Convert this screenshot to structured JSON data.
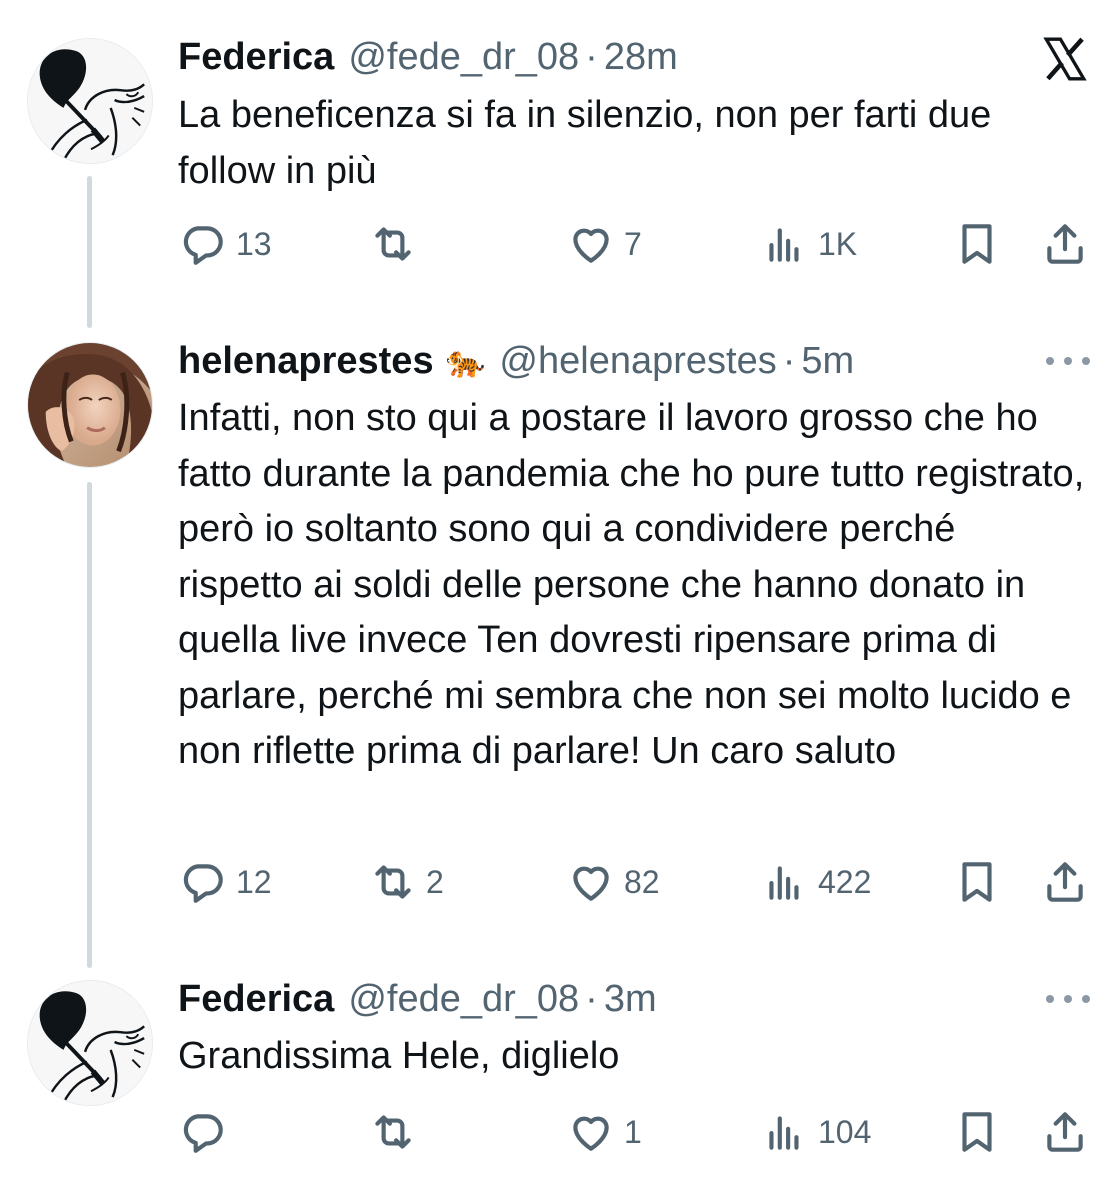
{
  "tweets": [
    {
      "display_name": "Federica",
      "handle": "@fede_dr_08",
      "separator": "·",
      "time": "28m",
      "text": "La beneficenza si fa in silenzio, non per farti due follow in più",
      "replies": "13",
      "retweets": "",
      "likes": "7",
      "views": "1K",
      "corner_icon": "x-logo-icon",
      "avatar": "sketch-avatar"
    },
    {
      "display_name": "helenaprestes",
      "name_emoji": "🐅",
      "handle": "@helenaprestes",
      "separator": "·",
      "time": "5m",
      "text": "Infatti, non sto qui a postare il lavoro grosso che ho fatto durante la pandemia che ho pure tutto registrato, però io soltanto sono qui a condividere perché rispetto ai soldi delle persone che hanno donato in quella live invece Ten dovresti ripensare prima di parlare, perché mi sembra che non sei molto lucido e non riflette prima di parlare! Un caro saluto",
      "replies": "12",
      "retweets": "2",
      "likes": "82",
      "views": "422",
      "corner_icon": "more-icon",
      "avatar": "photo-avatar"
    },
    {
      "display_name": "Federica",
      "handle": "@fede_dr_08",
      "separator": "·",
      "time": "3m",
      "text": "Grandissima Hele, diglielo",
      "replies": "",
      "retweets": "",
      "likes": "1",
      "views": "104",
      "corner_icon": "more-icon",
      "avatar": "sketch-avatar"
    }
  ],
  "colors": {
    "text": "#0f1419",
    "secondary": "#536471",
    "thread_line": "#cfd9de"
  }
}
